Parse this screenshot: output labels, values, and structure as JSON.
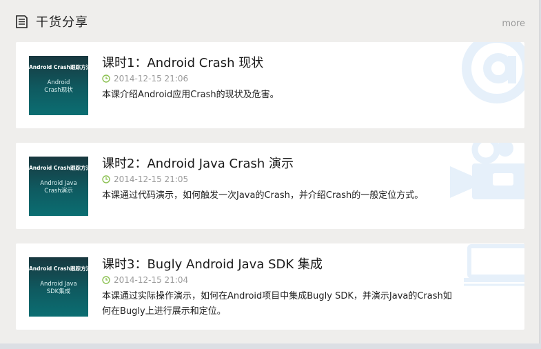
{
  "header": {
    "title": "干货分享",
    "more_label": "more"
  },
  "lessons": [
    {
      "thumb_brand": "Android Crash跟踪方法",
      "thumb_line1": "Android",
      "thumb_line2": "Crash现状",
      "title": "课时1：Android Crash 现状",
      "date": "2014-12-15 21:06",
      "description": "本课介绍Android应用Crash的现状及危害。",
      "decoration_icon": "at-sign-icon"
    },
    {
      "thumb_brand": "Android Crash跟踪方法",
      "thumb_line1": "Android Java",
      "thumb_line2": "Crash演示",
      "title": "课时2：Android Java Crash 演示",
      "date": "2014-12-15 21:05",
      "description": "本课通过代码演示，如何触发一次Java的Crash，并介绍Crash的一般定位方式。",
      "decoration_icon": "video-camera-icon"
    },
    {
      "thumb_brand": "Android Crash跟踪方法",
      "thumb_line1": "Android Java",
      "thumb_line2": "SDK集成",
      "title": "课时3：Bugly Android Java SDK 集成",
      "date": "2014-12-15 21:04",
      "description": "本课通过实际操作演示，如何在Android项目中集成Bugly SDK，并演示Java的Crash如何在Bugly上进行展示和定位。",
      "decoration_icon": "laptop-icon"
    }
  ],
  "colors": {
    "accent_green": "#8cc152",
    "thumb_bg": "#0f5a60",
    "deco_blue": "#e6f0fa"
  }
}
